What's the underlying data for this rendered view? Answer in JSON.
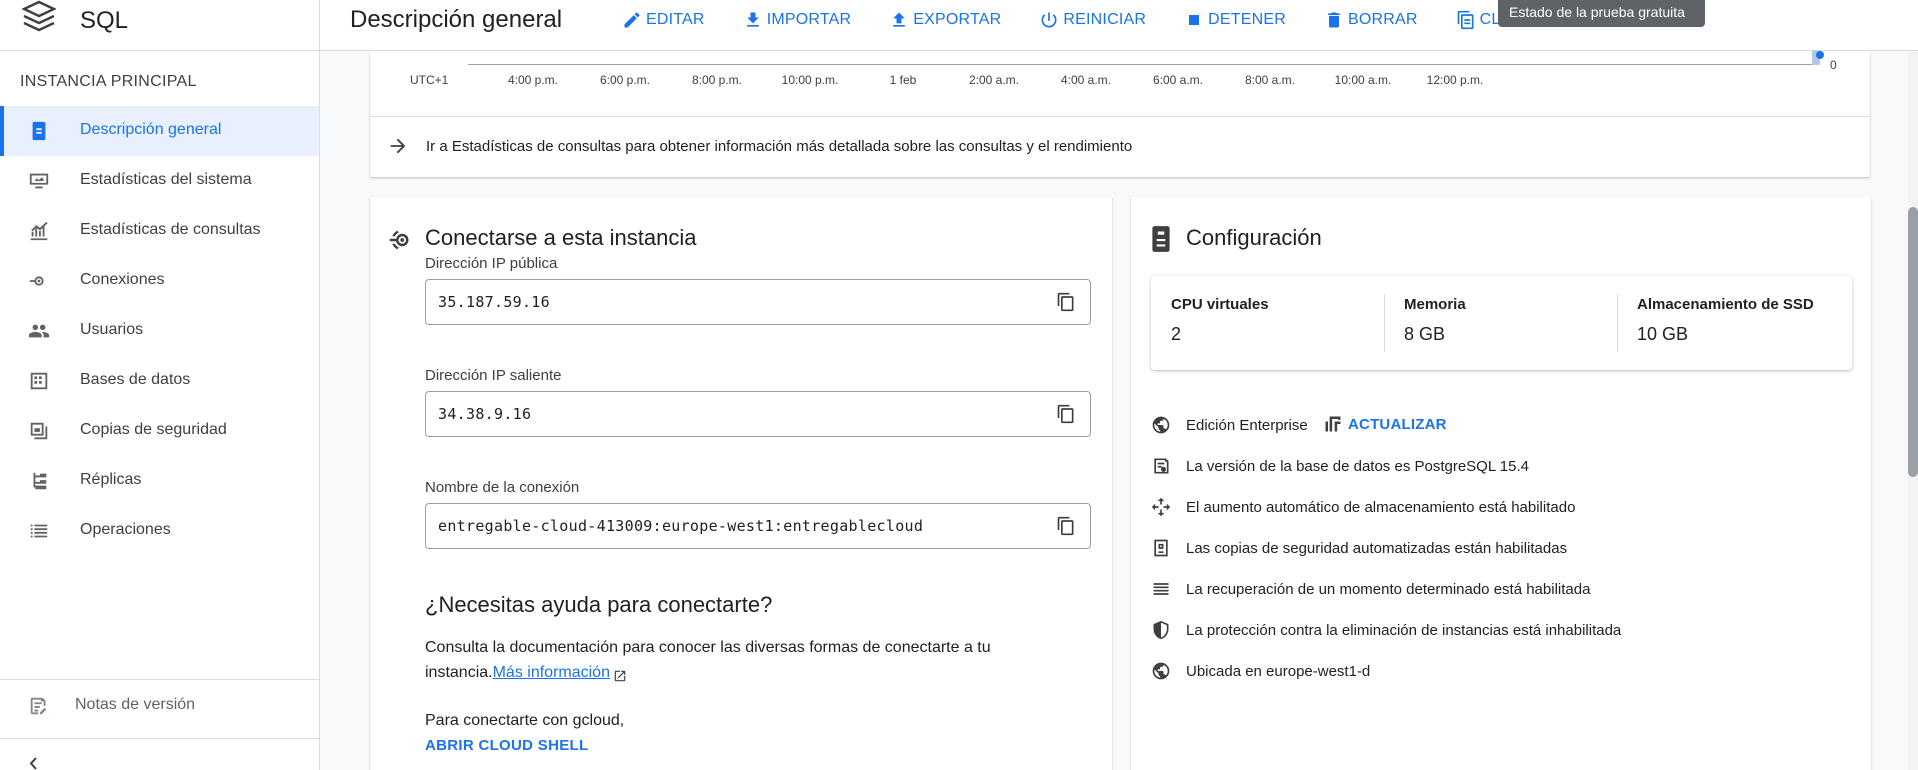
{
  "product": {
    "name": "SQL",
    "logo_icon": "cloud-sql-stack-icon"
  },
  "header": {
    "title": "Descripción general",
    "actions": [
      {
        "label": "EDITAR",
        "icon": "pencil-icon"
      },
      {
        "label": "IMPORTAR",
        "icon": "import-icon"
      },
      {
        "label": "EXPORTAR",
        "icon": "export-icon"
      },
      {
        "label": "REINICIAR",
        "icon": "power-icon"
      },
      {
        "label": "DETENER",
        "icon": "stop-icon"
      },
      {
        "label": "BORRAR",
        "icon": "trash-icon"
      },
      {
        "label": "CLO",
        "icon": "clone-icon"
      }
    ],
    "tooltip": "Estado de la prueba gratuita"
  },
  "sidebar": {
    "section_title": "INSTANCIA PRINCIPAL",
    "items": [
      {
        "label": "Descripción general",
        "icon": "overview-icon",
        "active": true
      },
      {
        "label": "Estadísticas del sistema",
        "icon": "monitor-icon"
      },
      {
        "label": "Estadísticas de consultas",
        "icon": "query-insights-icon"
      },
      {
        "label": "Conexiones",
        "icon": "connections-icon"
      },
      {
        "label": "Usuarios",
        "icon": "users-icon"
      },
      {
        "label": "Bases de datos",
        "icon": "databases-icon"
      },
      {
        "label": "Copias de seguridad",
        "icon": "backups-icon"
      },
      {
        "label": "Réplicas",
        "icon": "replicas-icon"
      },
      {
        "label": "Operaciones",
        "icon": "operations-icon"
      }
    ],
    "release_notes": "Notas de versión",
    "collapse_icon": "collapse-sidebar-icon"
  },
  "timeline": {
    "ticks": [
      "UTC+1",
      "4:00 p.m.",
      "6:00 p.m.",
      "8:00 p.m.",
      "10:00 p.m.",
      "1 feb",
      "2:00 a.m.",
      "4:00 a.m.",
      "6:00 a.m.",
      "8:00 a.m.",
      "10:00 a.m.",
      "12:00 p.m."
    ],
    "y_value_label": "0",
    "insights_link": "Ir a Estadísticas de consultas para obtener información más detallada sobre las consultas y el rendimiento"
  },
  "connect": {
    "title": "Conectarse a esta instancia",
    "public_ip_label": "Dirección IP pública",
    "public_ip": "35.187.59.16",
    "outgoing_ip_label": "Dirección IP saliente",
    "outgoing_ip": "34.38.9.16",
    "connection_name_label": "Nombre de la conexión",
    "connection_name": "entregable-cloud-413009:europe-west1:entregablecloud",
    "help_title": "¿Necesitas ayuda para conectarte?",
    "help_text": "Consulta la documentación para conocer las diversas formas de conectarte a tu instancia.",
    "help_link": "Más información",
    "gcloud_text": "Para conectarte con gcloud,",
    "cloud_shell_button": "ABRIR CLOUD SHELL"
  },
  "config": {
    "title": "Configuración",
    "specs": [
      {
        "label": "CPU virtuales",
        "value": "2"
      },
      {
        "label": "Memoria",
        "value": "8 GB"
      },
      {
        "label": "Almacenamiento de SSD",
        "value": "10 GB"
      }
    ],
    "edition": "Edición Enterprise",
    "upgrade_label": "ACTUALIZAR",
    "items": [
      {
        "text": "La versión de la base de datos es PostgreSQL 15.4",
        "icon": "database-version-icon"
      },
      {
        "text": "El aumento automático de almacenamiento está habilitado",
        "icon": "auto-storage-icon"
      },
      {
        "text": "Las copias de seguridad automatizadas están habilitadas",
        "icon": "backup-icon"
      },
      {
        "text": "La recuperación de un momento determinado está habilitada",
        "icon": "point-in-time-icon"
      },
      {
        "text": "La protección contra la eliminación de instancias está inhabilitada",
        "icon": "shield-icon"
      },
      {
        "text": "Ubicada en europe-west1-d",
        "icon": "globe-icon"
      }
    ]
  }
}
